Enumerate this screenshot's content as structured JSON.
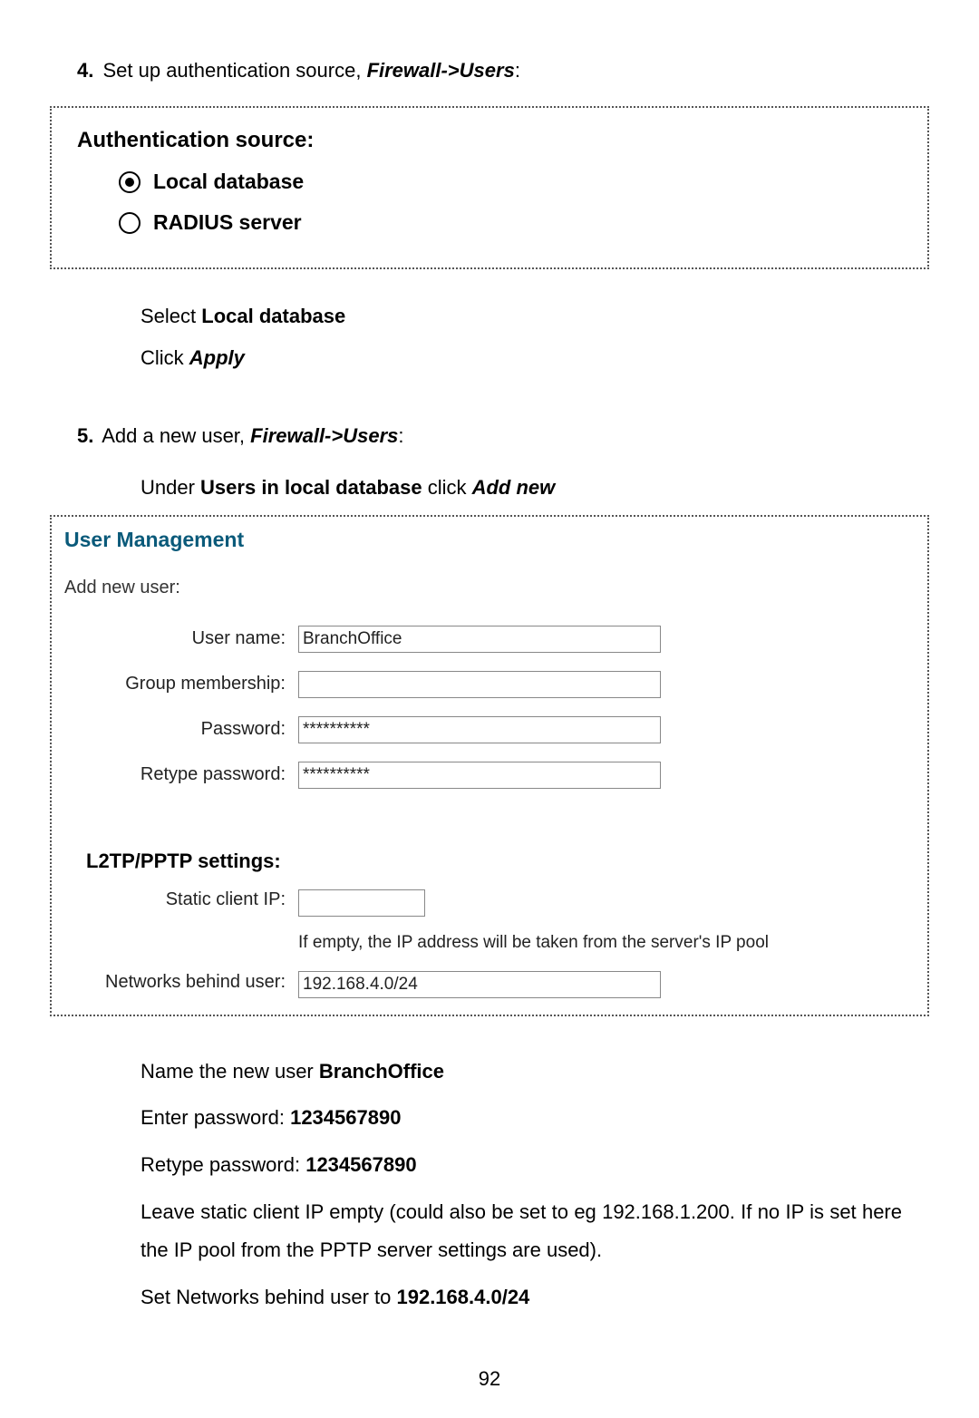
{
  "step4": {
    "number": "4.",
    "text_before": " Set up authentication source, ",
    "path": "Firewall->Users",
    "text_after": ":"
  },
  "auth_panel": {
    "title": "Authentication source:",
    "options": {
      "local": "Local database",
      "radius": "RADIUS server"
    }
  },
  "instr1": {
    "line1_prefix": "Select ",
    "line1_bold": "Local database",
    "line2_prefix": "Click ",
    "line2_boldit": "Apply"
  },
  "step5": {
    "number": "5.",
    "text_before": " Add a new user, ",
    "path": "Firewall->Users",
    "text_after": ":",
    "under_prefix": "Under ",
    "under_bold1": "Users in local database",
    "under_mid": " click ",
    "under_boldit": "Add new"
  },
  "um": {
    "title": "User Management",
    "add_new_user": "Add new user:",
    "labels": {
      "username": "User name:",
      "group": "Group membership:",
      "password": "Password:",
      "retype": "Retype password:",
      "static_ip": "Static client IP:",
      "networks": "Networks behind user:",
      "section": "L2TP/PPTP settings:"
    },
    "values": {
      "username": "BranchOffice",
      "group": "",
      "password": "**********",
      "retype": "**********",
      "static_ip": "",
      "networks": "192.168.4.0/24"
    },
    "hint": "If empty, the IP address will be taken from the server's IP pool"
  },
  "post": {
    "l1_prefix": "Name the new user ",
    "l1_bold": "BranchOffice",
    "l2_prefix": "Enter password: ",
    "l2_bold": "1234567890",
    "l3_prefix": "Retype password: ",
    "l3_bold": "1234567890",
    "l4": "Leave static client IP empty (could also be set to eg 192.168.1.200. If no IP is set here the IP pool from the PPTP server settings are used).",
    "l5_prefix": "Set Networks behind user to ",
    "l5_bold": "192.168.4.0/24"
  },
  "page_number": "92"
}
